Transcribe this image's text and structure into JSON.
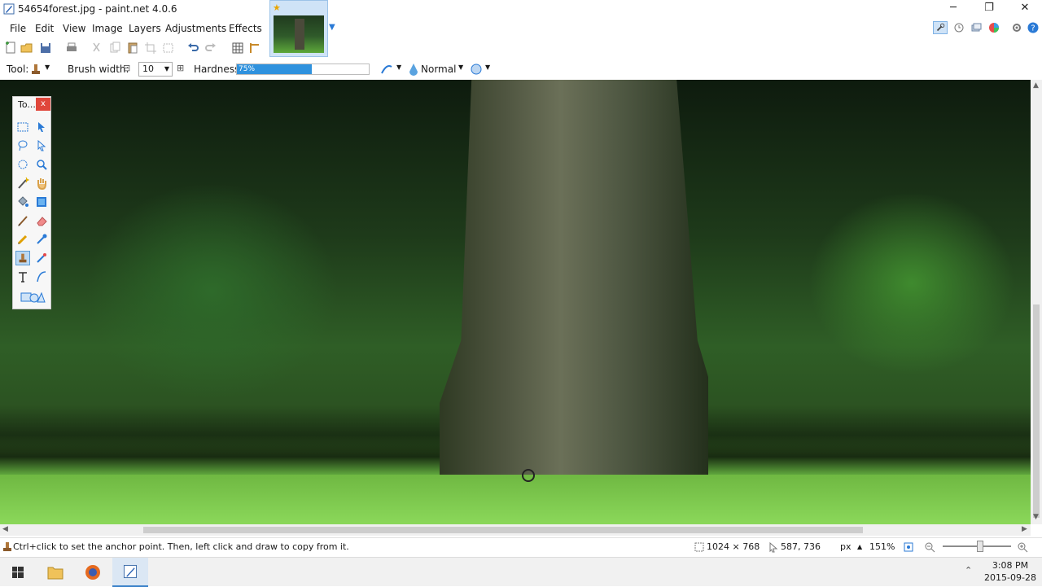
{
  "window": {
    "title": "54654forest.jpg - paint.net 4.0.6",
    "minimize": "─",
    "maximize": "❐",
    "close": "✕"
  },
  "menu": [
    "File",
    "Edit",
    "View",
    "Image",
    "Layers",
    "Adjustments",
    "Effects"
  ],
  "options": {
    "tool_label": "Tool:",
    "brush_width_label": "Brush width:",
    "brush_width_value": "10",
    "hardness_label": "Hardness:",
    "hardness_value": "75%",
    "hardness_fraction": 0.75,
    "blend_mode": "Normal"
  },
  "tools_window": {
    "title": "To...",
    "close": "x"
  },
  "status": {
    "hint": "Ctrl+click to set the anchor point. Then, left click and draw to copy from it.",
    "image_size": "1024 × 768",
    "cursor_position": "587, 736",
    "units": "px",
    "zoom": "151%"
  },
  "taskbar": {
    "time": "3:08 PM",
    "date": "2015-09-28"
  },
  "colors": {
    "accent": "#2f92de",
    "close_red": "#e0473b",
    "selection": "#bcd9f3"
  }
}
